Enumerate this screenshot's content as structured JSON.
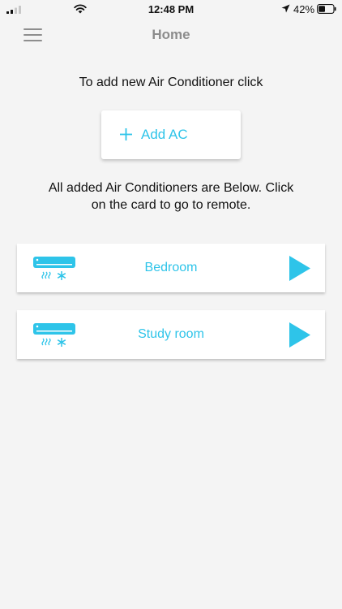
{
  "status_bar": {
    "time": "12:48 PM",
    "battery": "42%"
  },
  "header": {
    "title": "Home"
  },
  "add_section": {
    "prompt": "To add new Air Conditioner click",
    "button_label": "Add AC"
  },
  "cards_section": {
    "intro_line1": "All added Air Conditioners are Below. Click",
    "intro_line2": "on the card to go to remote.",
    "cards": [
      {
        "name": "Bedroom"
      },
      {
        "name": "Study room"
      }
    ]
  },
  "colors": {
    "accent": "#2ec4e9",
    "background": "#f4f4f4",
    "title_gray": "#8c8c8c"
  },
  "icons": {
    "menu": "hamburger-menu-icon",
    "add": "plus-icon",
    "ac_unit": "air-conditioner-icon",
    "open_remote": "play-icon"
  }
}
